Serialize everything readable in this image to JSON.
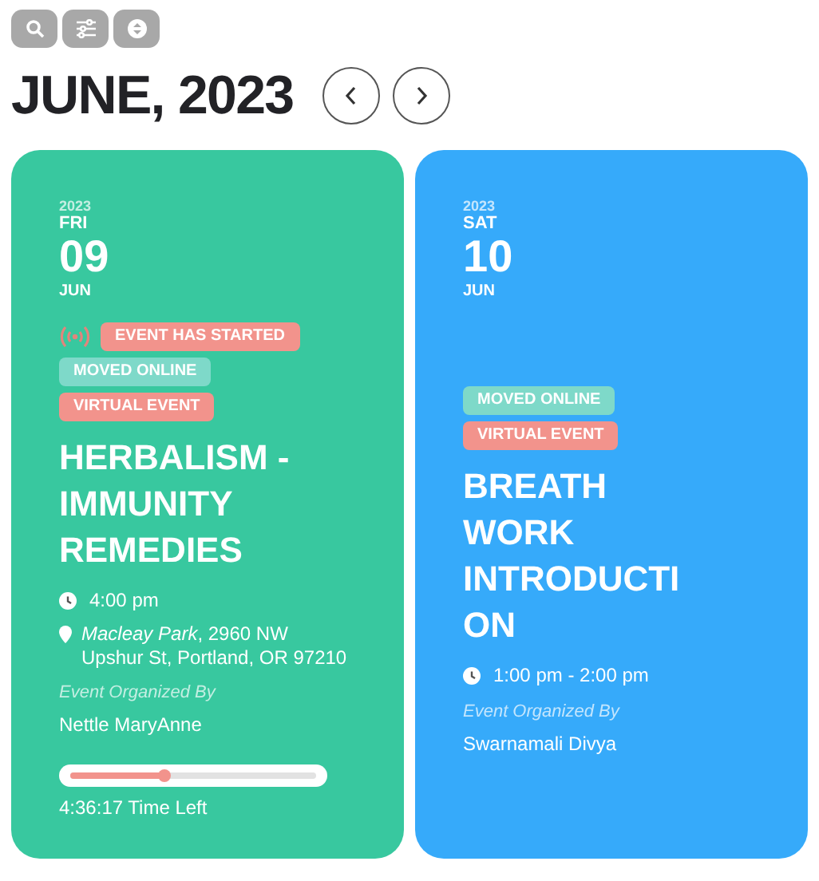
{
  "toolbar": [
    {
      "kind": "search"
    },
    {
      "kind": "filter"
    },
    {
      "kind": "sort"
    }
  ],
  "heading": "JUNE, 2023",
  "nav": [
    {
      "kind": "prev"
    },
    {
      "kind": "next"
    }
  ],
  "events": [
    {
      "color": "#38c89f",
      "year": "2023",
      "weekday": "FRI",
      "day": "09",
      "month": "JUN",
      "tags": [
        {
          "kind": "started",
          "label": "EVENT HAS STARTED",
          "color": "#f2938c"
        },
        {
          "kind": "plain",
          "label": "MOVED ONLINE",
          "color": "#7ed9c9"
        },
        {
          "kind": "plain",
          "label": "VIRTUAL EVENT",
          "color": "#f2938c"
        }
      ],
      "title_lines": [
        "HERBALISM -",
        "IMMUNITY",
        "REMEDIES"
      ],
      "time": "4:00 pm",
      "venue": "Macleay Park",
      "address": ", 2960 NW Upshur St, Portland, OR 97210",
      "organizer_label": "Event Organized By",
      "organizer": "Nettle MaryAnne",
      "progress": {
        "level": 0.38,
        "reading": "4:36:17 Time Left"
      }
    },
    {
      "color": "#36aafa",
      "year": "2023",
      "weekday": "SAT",
      "day": "10",
      "month": "JUN",
      "tags": [
        {
          "kind": "plain",
          "label": "MOVED ONLINE",
          "color": "#7ed9c9"
        },
        {
          "kind": "plain",
          "label": "VIRTUAL EVENT",
          "color": "#f2938c"
        }
      ],
      "title_lines": [
        "BREATH",
        "WORK",
        "INTRODUCTI",
        "ON"
      ],
      "time": "1:00 pm - 2:00 pm",
      "organizer_label": "Event Organized By",
      "organizer": "Swarnamali Divya"
    }
  ]
}
